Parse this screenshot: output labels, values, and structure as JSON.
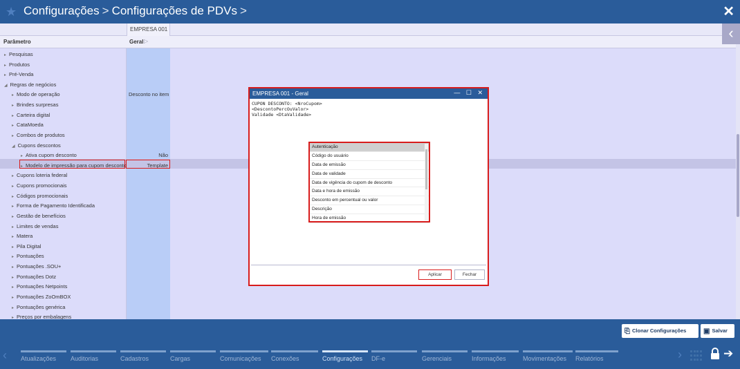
{
  "topbar": {
    "crumb1": "Configurações",
    "sep": ">",
    "crumb2": "Configurações de PDVs",
    "close": "✕"
  },
  "grid": {
    "column_header": "EMPRESA 001",
    "param_header": "Parâmetro",
    "group_header": "Geral"
  },
  "tree": [
    {
      "label": "Pesquisas",
      "indent": 0,
      "expanded": false
    },
    {
      "label": "Produtos",
      "indent": 0,
      "expanded": false
    },
    {
      "label": "Pré-Venda",
      "indent": 0,
      "expanded": false
    },
    {
      "label": "Regras de negócios",
      "indent": 0,
      "expanded": true
    },
    {
      "label": "Modo de operação",
      "indent": 1,
      "expanded": false,
      "value": "Desconto no item"
    },
    {
      "label": "Brindes surpresas",
      "indent": 1,
      "expanded": false
    },
    {
      "label": "Carteira digital",
      "indent": 1,
      "expanded": false
    },
    {
      "label": "CataMoeda",
      "indent": 1,
      "expanded": false
    },
    {
      "label": "Combos de produtos",
      "indent": 1,
      "expanded": false
    },
    {
      "label": "Cupons descontos",
      "indent": 1,
      "expanded": true
    },
    {
      "label": "Ativa cupom desconto",
      "indent": 2,
      "expanded": false,
      "value": "Não"
    },
    {
      "label": "Modelo de impressão para cupom desconto",
      "indent": 2,
      "expanded": false,
      "value": "Template",
      "selected": true
    },
    {
      "label": "Cupons loteria federal",
      "indent": 1,
      "expanded": false
    },
    {
      "label": "Cupons promocionais",
      "indent": 1,
      "expanded": false
    },
    {
      "label": "Códigos promocionais",
      "indent": 1,
      "expanded": false
    },
    {
      "label": "Forma de Pagamento Identificada",
      "indent": 1,
      "expanded": false
    },
    {
      "label": "Gestão de benefícios",
      "indent": 1,
      "expanded": false
    },
    {
      "label": "Limites de vendas",
      "indent": 1,
      "expanded": false
    },
    {
      "label": "Matera",
      "indent": 1,
      "expanded": false
    },
    {
      "label": "Pila Digital",
      "indent": 1,
      "expanded": false
    },
    {
      "label": "Pontuações",
      "indent": 1,
      "expanded": false
    },
    {
      "label": "Pontuações .SOU+",
      "indent": 1,
      "expanded": false
    },
    {
      "label": "Pontuações Dotz",
      "indent": 1,
      "expanded": false
    },
    {
      "label": "Pontuações Netpoints",
      "indent": 1,
      "expanded": false
    },
    {
      "label": "Pontuações ZoOmBOX",
      "indent": 1,
      "expanded": false
    },
    {
      "label": "Pontuações genérica",
      "indent": 1,
      "expanded": false
    },
    {
      "label": "Preços por embalagens",
      "indent": 1,
      "expanded": false
    }
  ],
  "modal": {
    "title": "EMPRESA 001 - Geral",
    "controls": "— ☐ ✕",
    "content": "CUPON DESCONTO: <NroCupom>\n<DescontoPercOuValor>\nValidade <DtaValidade>",
    "apply": "Aplicar",
    "close": "Fechar"
  },
  "dropdown": {
    "items": [
      "Autenticação",
      "Código do usuário",
      "Data de emissão",
      "Data de validade",
      "Data de vigência do cupom de desconto",
      "Data e hora de emissão",
      "Desconto em percentual ou valor",
      "Descrição",
      "Hora de emissão"
    ],
    "highlighted_index": 0
  },
  "actions": {
    "clone": "Clonar Configurações",
    "save": "Salvar"
  },
  "nav": {
    "tabs": [
      "Atualizações",
      "Auditorias",
      "Cadastros",
      "Cargas",
      "Comunicações",
      "Conexões",
      "Configurações",
      "DF-e",
      "Gerenciais",
      "Informações",
      "Movimentações",
      "Relatórios"
    ],
    "active": "Configurações"
  },
  "colors": {
    "brand": "#2a5c9a",
    "highlight_border": "#d81b1b",
    "background": "#dcdcfa"
  }
}
